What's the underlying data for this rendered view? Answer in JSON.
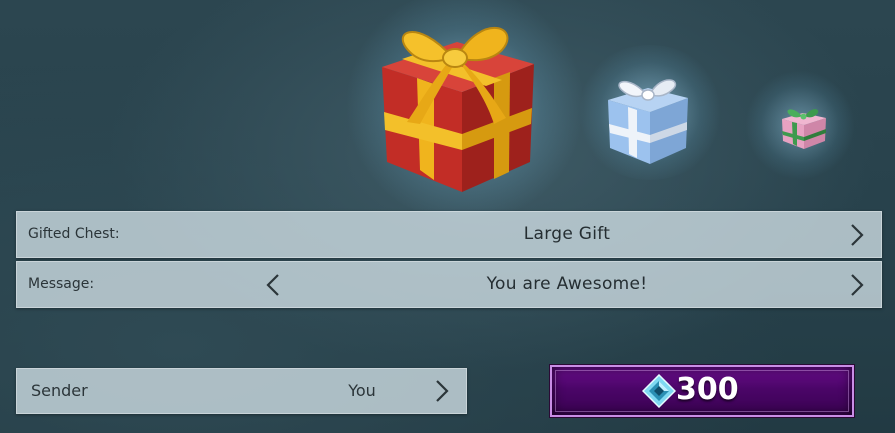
{
  "gifts": [
    {
      "icon": "large-gift-icon",
      "box_color": "#c6302a",
      "ribbon_color": "#f2b81c"
    },
    {
      "icon": "medium-gift-icon",
      "box_color": "#8fb8e8",
      "ribbon_color": "#e8eef6"
    },
    {
      "icon": "small-gift-icon",
      "box_color": "#e7a2c2",
      "ribbon_color": "#3e9a4e"
    }
  ],
  "chest_row": {
    "label": "Gifted Chest:",
    "value": "Large Gift"
  },
  "message_row": {
    "label": "Message:",
    "value": "You are Awesome!"
  },
  "sender_row": {
    "label": "Sender",
    "value": "You"
  },
  "buy": {
    "price": "300",
    "currency_icon": "crystal-icon",
    "accent": "#5a0a7a"
  }
}
